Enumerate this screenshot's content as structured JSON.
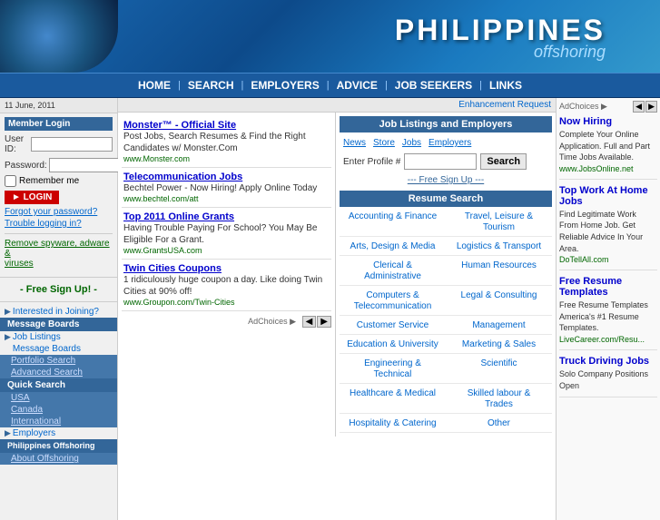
{
  "header": {
    "title": "PHILIPPINES",
    "subtitle": "offshoring"
  },
  "navbar": {
    "items": [
      "HOME",
      "SEARCH",
      "EMPLOYERS",
      "ADVICE",
      "JOB SEEKERS",
      "LINKS"
    ]
  },
  "sidebar": {
    "date": "11 June, 2011",
    "member_login": "Member Login",
    "user_id_label": "User ID:",
    "password_label": "Password:",
    "remember_me": "Remember me",
    "login_btn": "► LOGIN",
    "forgot_password": "Forgot your password?",
    "trouble_login": "Trouble logging in?",
    "remove_spyware": "Remove spyware, adware &\nviruses",
    "free_signup": "- Free Sign Up! -",
    "nav_items": [
      {
        "label": "Interested in Joining?",
        "active": false
      },
      {
        "label": "Message Boards",
        "active": true
      },
      {
        "label": "Job Listings",
        "active": false
      },
      {
        "label": "Message Boards",
        "active": false
      },
      {
        "label": "Portfolio Search",
        "active": false
      },
      {
        "label": "Advanced Search",
        "active": false
      },
      {
        "label": "Quick Search",
        "active": true
      },
      {
        "label": "USA",
        "active": false
      },
      {
        "label": "Canada",
        "active": false
      },
      {
        "label": "International",
        "active": false
      },
      {
        "label": "Employers",
        "active": false
      },
      {
        "label": "Philippines Offshoring",
        "active": false
      },
      {
        "label": "About Offshoring",
        "active": false
      }
    ]
  },
  "enhancement_bar": {
    "text": "Enhancement Request"
  },
  "ads": [
    {
      "title": "Monster™ - Official Site",
      "text": "Post Jobs, Search Resumes & Find the Right Candidates w/ Monster.Com",
      "url": "www.Monster.com"
    },
    {
      "title": "Telecommunication Jobs",
      "text": "Bechtel Power - Now Hiring! Apply Online Today",
      "url": "www.bechtel.com/att"
    },
    {
      "title": "Top 2011 Online Grants",
      "text": "Having Trouble Paying For School? You May Be Eligible For a Grant.",
      "url": "www.GrantsUSA.com"
    },
    {
      "title": "Twin Cities Coupons",
      "text": "1 ridiculously huge coupon a day. Like doing Twin Cities at 90% off!",
      "url": "www.Groupon.com/Twin-Cities"
    }
  ],
  "job_listings": {
    "title": "Job Listings and Employers",
    "tabs": [
      "News",
      "Store",
      "Jobs",
      "Employers"
    ],
    "profile_label": "Enter Profile #",
    "search_btn": "Search",
    "free_signup": "--- Free Sign Up ---"
  },
  "resume_search": {
    "title": "Resume Search",
    "categories": [
      {
        "left": "Accounting & Finance",
        "right": "Travel, Leisure & Tourism"
      },
      {
        "left": "Arts, Design & Media",
        "right": "Logistics & Transport"
      },
      {
        "left": "Clerical & Administrative",
        "right": "Human Resources"
      },
      {
        "left": "Computers & Telecommunication",
        "right": "Legal & Consulting"
      },
      {
        "left": "Customer Service",
        "right": "Management"
      },
      {
        "left": "Education & University",
        "right": "Marketing & Sales"
      },
      {
        "left": "Engineering & Technical",
        "right": "Scientific"
      },
      {
        "left": "Healthcare & Medical",
        "right": "Skilled labour & Trades"
      },
      {
        "left": "Hospitality & Catering",
        "right": "Other"
      }
    ]
  },
  "right_sidebar": {
    "adchoices": "AdChoices ▶",
    "ads": [
      {
        "title": "Now Hiring",
        "text": "Complete Your Online Application. Full and Part Time Jobs Available.",
        "url": "www.JobsOnline.net"
      },
      {
        "title": "Top Work At Home Jobs",
        "text": "Find Legitimate Work From Home Job. Get Reliable Advice In Your Area.",
        "url": "DoTellAll.com"
      },
      {
        "title": "Free Resume Templates",
        "text": "Free Resume Templates America's #1 Resume Templates.",
        "url": "LiveCareer.com/Resu..."
      },
      {
        "title": "Truck Driving Jobs",
        "text": "Solo Company Positions Open",
        "url": ""
      }
    ]
  }
}
